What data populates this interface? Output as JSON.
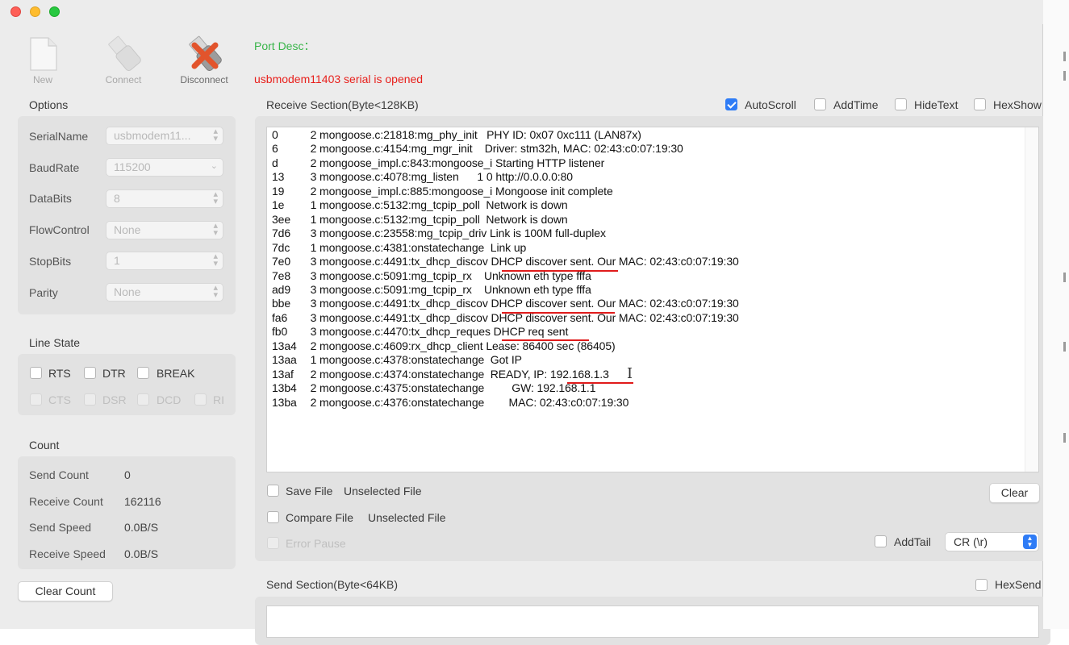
{
  "toolbar": {
    "new_label": "New",
    "connect_label": "Connect",
    "disconnect_label": "Disconnect"
  },
  "port_desc": "Port Desc：",
  "status_text": "usbmodem11403 serial is opened",
  "options": {
    "title": "Options",
    "fields": [
      {
        "label": "SerialName",
        "value": "usbmodem11...",
        "icon": "updown-icon"
      },
      {
        "label": "BaudRate",
        "value": "115200",
        "icon": "chevron-down-icon"
      },
      {
        "label": "DataBits",
        "value": "8",
        "icon": "updown-icon"
      },
      {
        "label": "FlowControl",
        "value": "None",
        "icon": "updown-icon"
      },
      {
        "label": "StopBits",
        "value": "1",
        "icon": "updown-icon"
      },
      {
        "label": "Parity",
        "value": "None",
        "icon": "updown-icon"
      }
    ]
  },
  "line_state": {
    "title": "Line State",
    "rts": "RTS",
    "dtr": "DTR",
    "break": "BREAK",
    "cts": "CTS",
    "dsr": "DSR",
    "dcd": "DCD",
    "ri": "RI"
  },
  "count": {
    "title": "Count",
    "send_count_label": "Send Count",
    "send_count": "0",
    "receive_count_label": "Receive Count",
    "receive_count": "162116",
    "send_speed_label": "Send Speed",
    "send_speed": "0.0B/S",
    "receive_speed_label": "Receive Speed",
    "receive_speed": "0.0B/S",
    "clear_label": "Clear Count"
  },
  "receive": {
    "title": "Receive Section(Byte<128KB)",
    "autoscroll": "AutoScroll",
    "autoscroll_checked": true,
    "addtime": "AddTime",
    "hidetext": "HideText",
    "hexshow": "HexShow",
    "lines": [
      {
        "id": "0",
        "msg": "  2 mongoose.c:21818:mg_phy_init   PHY ID: 0x07 0xc111 (LAN87x)"
      },
      {
        "id": "6",
        "msg": "  2 mongoose.c:4154:mg_mgr_init    Driver: stm32h, MAC: 02:43:c0:07:19:30"
      },
      {
        "id": "d",
        "msg": "  2 mongoose_impl.c:843:mongoose_i Starting HTTP listener"
      },
      {
        "id": "13",
        "msg": "  3 mongoose.c:4078:mg_listen      1 0 http://0.0.0.0:80"
      },
      {
        "id": "19",
        "msg": "  2 mongoose_impl.c:885:mongoose_i Mongoose init complete"
      },
      {
        "id": "1e",
        "msg": "  1 mongoose.c:5132:mg_tcpip_poll  Network is down"
      },
      {
        "id": "3ee",
        "msg": "  1 mongoose.c:5132:mg_tcpip_poll  Network is down"
      },
      {
        "id": "7d6",
        "msg": "  3 mongoose.c:23558:mg_tcpip_driv Link is 100M full-duplex"
      },
      {
        "id": "7dc",
        "msg": "  1 mongoose.c:4381:onstatechange  Link up"
      },
      {
        "id": "7e0",
        "msg": "  3 mongoose.c:4491:tx_dhcp_discov DHCP discover sent. Our MAC: 02:43:c0:07:19:30"
      },
      {
        "id": "7e8",
        "msg": "  3 mongoose.c:5091:mg_tcpip_rx    Unknown eth type fffa"
      },
      {
        "id": "ad9",
        "msg": "  3 mongoose.c:5091:mg_tcpip_rx    Unknown eth type fffa"
      },
      {
        "id": "bbe",
        "msg": "  3 mongoose.c:4491:tx_dhcp_discov DHCP discover sent. Our MAC: 02:43:c0:07:19:30"
      },
      {
        "id": "fa6",
        "msg": "  3 mongoose.c:4491:tx_dhcp_discov DHCP discover sent. Our MAC: 02:43:c0:07:19:30"
      },
      {
        "id": "fb0",
        "msg": "  3 mongoose.c:4470:tx_dhcp_reques DHCP req sent"
      },
      {
        "id": "13a4",
        "msg": "  2 mongoose.c:4609:rx_dhcp_client Lease: 86400 sec (86405)"
      },
      {
        "id": "13aa",
        "msg": "  1 mongoose.c:4378:onstatechange  Got IP"
      },
      {
        "id": "13af",
        "msg": "  2 mongoose.c:4374:onstatechange  READY, IP: 192.168.1.3"
      },
      {
        "id": "13b4",
        "msg": "  2 mongoose.c:4375:onstatechange         GW: 192.168.1.1"
      },
      {
        "id": "13ba",
        "msg": "  2 mongoose.c:4376:onstatechange        MAC: 02:43:c0:07:19:30"
      }
    ],
    "save_file": "Save File",
    "save_file_value": "Unselected File",
    "compare_file": "Compare File",
    "compare_file_value": "Unselected File",
    "error_pause": "Error Pause",
    "clear_label": "Clear",
    "addtail": "AddTail",
    "tail_value": "CR (\\r)"
  },
  "send": {
    "title": "Send Section(Byte<64KB)",
    "hexsend": "HexSend"
  },
  "colors": {
    "accent": "#2f7cf6",
    "status_red": "#e8201c",
    "port_green": "#39b54a",
    "annotation_red": "#e01b1b"
  }
}
